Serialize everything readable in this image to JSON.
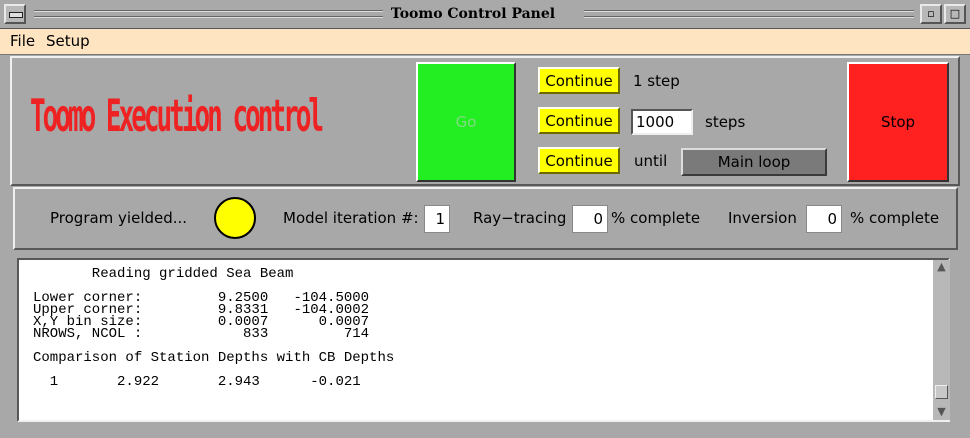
{
  "window": {
    "title": "Toomo Control Panel"
  },
  "menu": {
    "file": "File",
    "setup": "Setup"
  },
  "control": {
    "logo_text": "Toomo Execution control",
    "go_label": "Go",
    "stop_label": "Stop",
    "continue_label": "Continue",
    "step_label": "1 step",
    "steps_value": "1000",
    "steps_label": "steps",
    "until_label": "until",
    "until_target": "Main loop"
  },
  "status": {
    "program_state": "Program yielded...",
    "indicator_color": "#ffff00",
    "model_iteration_label": "Model iteration #:",
    "model_iteration_value": "1",
    "raytracing_label": "Ray−tracing",
    "raytracing_value": "0",
    "raytracing_suffix": "% complete",
    "inversion_label": "Inversion",
    "inversion_value": "0",
    "inversion_suffix": "% complete"
  },
  "console": {
    "lines": [
      "       Reading gridded Sea Beam",
      "",
      "Lower corner:         9.2500   -104.5000",
      "Upper corner:         9.8331   -104.0002",
      "X,Y bin size:         0.0007      0.0007",
      "NROWS, NCOL :            833         714",
      "",
      "Comparison of Station Depths with CB Depths",
      "",
      "  1       2.922       2.943      -0.021"
    ]
  },
  "colors": {
    "go": "#22ee22",
    "stop": "#ff2020",
    "continue": "#ffff00",
    "menubar": "#ffe4c2"
  }
}
